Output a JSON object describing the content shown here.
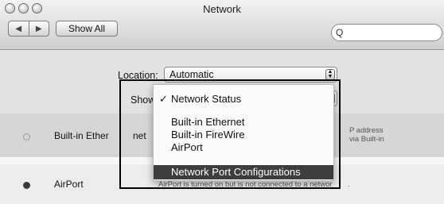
{
  "window": {
    "title": "Network"
  },
  "toolbar": {
    "back_glyph": "◀",
    "forward_glyph": "▶",
    "show_all_label": "Show All",
    "search_icon": "magnifier-icon",
    "search_glyph": "Q"
  },
  "location": {
    "label": "Location:",
    "value": "Automatic"
  },
  "show": {
    "label": "Show"
  },
  "menu": {
    "items": [
      {
        "label": "Network Status",
        "checked": true
      },
      {
        "label": "Built-in Ethernet"
      },
      {
        "label": "Built-in FireWire"
      },
      {
        "label": "AirPort"
      },
      {
        "label": "Network Port Configurations",
        "highlighted": true
      }
    ],
    "check_glyph": "✓"
  },
  "services": [
    {
      "name": "Built-in Ether",
      "name_right": "net",
      "status_color": "#9a9a9a",
      "desc_line1": "P address",
      "desc_line2": "via Built-in"
    },
    {
      "name": "AirPort",
      "status_color": "#3a3a3a",
      "desc": "AirPort is turned on but is not connected to a networ",
      "desc_tail": "."
    }
  ],
  "colors": {
    "highlight": "#3d3d3d",
    "window_bg": "#e2e2e2"
  }
}
